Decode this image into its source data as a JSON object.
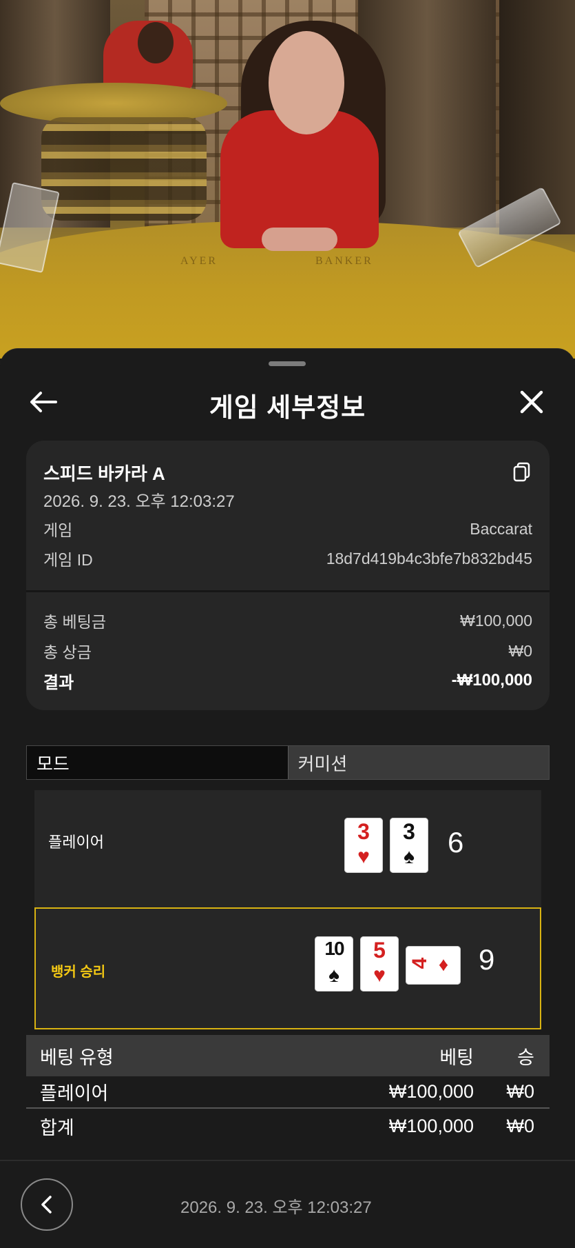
{
  "video": {
    "felt_labels": [
      "AYER",
      "BANKER"
    ]
  },
  "header": {
    "title": "게임 세부정보"
  },
  "summary": {
    "game_name": "스피드 바카라 A",
    "datetime": "2026. 9. 23. 오후 12:03:27",
    "game_label": "게임",
    "game_value": "Baccarat",
    "game_id_label": "게임 ID",
    "game_id_value": "18d7d419b4c3bfe7b832bd45",
    "total_bet_label": "총 베팅금",
    "total_bet_value": "₩100,000",
    "total_win_label": "총 상금",
    "total_win_value": "₩0",
    "result_label": "결과",
    "result_value": "-₩100,000"
  },
  "tabs": [
    {
      "label": "모드",
      "active": true
    },
    {
      "label": "커미션",
      "active": false
    }
  ],
  "hands": {
    "player": {
      "label": "플레이어",
      "score": "6",
      "cards": [
        {
          "rank": "3",
          "suit": "♥",
          "color": "red"
        },
        {
          "rank": "3",
          "suit": "♠",
          "color": "black"
        }
      ]
    },
    "banker": {
      "label": "뱅커 승리",
      "score": "9",
      "cards": [
        {
          "rank": "10",
          "suit": "♠",
          "color": "black"
        },
        {
          "rank": "5",
          "suit": "♥",
          "color": "red"
        },
        {
          "rank": "4",
          "suit": "♦",
          "color": "red"
        }
      ]
    }
  },
  "bets": {
    "headers": [
      "베팅 유형",
      "베팅",
      "승"
    ],
    "rows": [
      {
        "type": "플레이어",
        "bet": "₩100,000",
        "win": "₩0"
      }
    ],
    "total": {
      "type": "합계",
      "bet": "₩100,000",
      "win": "₩0"
    }
  },
  "footer": {
    "datetime": "2026. 9. 23. 오후 12:03:27"
  },
  "colors": {
    "accent_gold": "#f3c814",
    "card_red": "#d42020"
  }
}
